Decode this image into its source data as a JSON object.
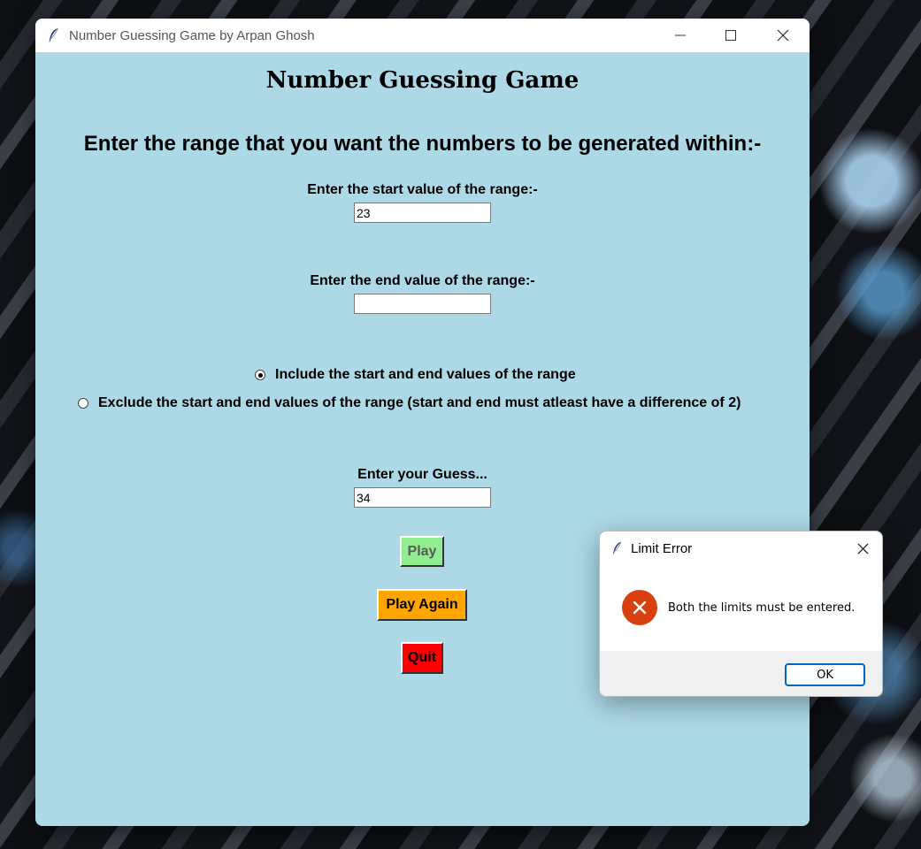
{
  "window": {
    "title": "Number Guessing Game by Arpan Ghosh",
    "bg_color": "#add8e6"
  },
  "main": {
    "heading": "Number Guessing Game",
    "subheading": "Enter the range that you want the numbers to be generated within:-",
    "start_label": "Enter the start value of the range:-",
    "start_value": "23",
    "end_label": "Enter the end value of the range:-",
    "end_value": "",
    "radio_include_label": "Include the start and end values of the range",
    "radio_exclude_label": "Exclude the start and end values of the range (start and end must atleast have a difference of 2)",
    "selected_radio": "include",
    "guess_label": "Enter your Guess...",
    "guess_value": "34",
    "play_label": "Play",
    "play_again_label": "Play Again",
    "quit_label": "Quit"
  },
  "dialog": {
    "title": "Limit Error",
    "message": "Both the limits must be entered.",
    "ok_label": "OK",
    "icon": "error-icon"
  },
  "colors": {
    "play": "#90ee90",
    "play_again": "#ffa500",
    "quit": "#ff0000",
    "error": "#d8400f"
  }
}
